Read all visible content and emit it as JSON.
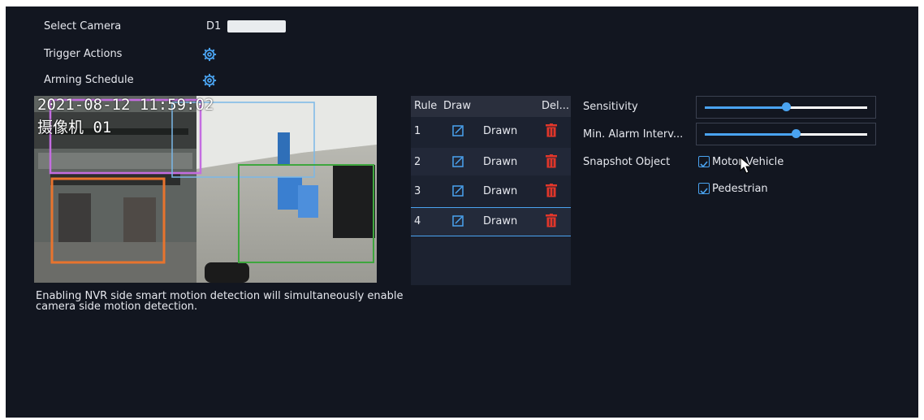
{
  "settings": {
    "select_camera_label": "Select Camera",
    "camera_name": "D1",
    "trigger_actions_label": "Trigger Actions",
    "arming_schedule_label": "Arming Schedule"
  },
  "preview": {
    "timestamp": "2021-08-12 11:59:02",
    "osd_title": "摄像机 01"
  },
  "note": "Enabling NVR side smart motion detection will simultaneously enable camera side motion detection.",
  "rules_table": {
    "headers": [
      "Rule",
      "Draw",
      "Del..."
    ],
    "rows": [
      {
        "rule": "1",
        "status": "Drawn"
      },
      {
        "rule": "2",
        "status": "Drawn"
      },
      {
        "rule": "3",
        "status": "Drawn"
      },
      {
        "rule": "4",
        "status": "Drawn"
      }
    ],
    "selected_row": 4
  },
  "detection": {
    "sensitivity_label": "Sensitivity",
    "sensitivity_value": 0.5,
    "min_alarm_interval_label": "Min. Alarm Interv...",
    "min_alarm_interval_value": 0.56,
    "snapshot_object_label": "Snapshot Object",
    "motor_vehicle_label": "Motor Vehicle",
    "motor_vehicle_checked": true,
    "pedestrian_label": "Pedestrian",
    "pedestrian_checked": true
  },
  "colors": {
    "background": "#121620",
    "accent": "#4aa3f0",
    "delete": "#e0362a"
  }
}
